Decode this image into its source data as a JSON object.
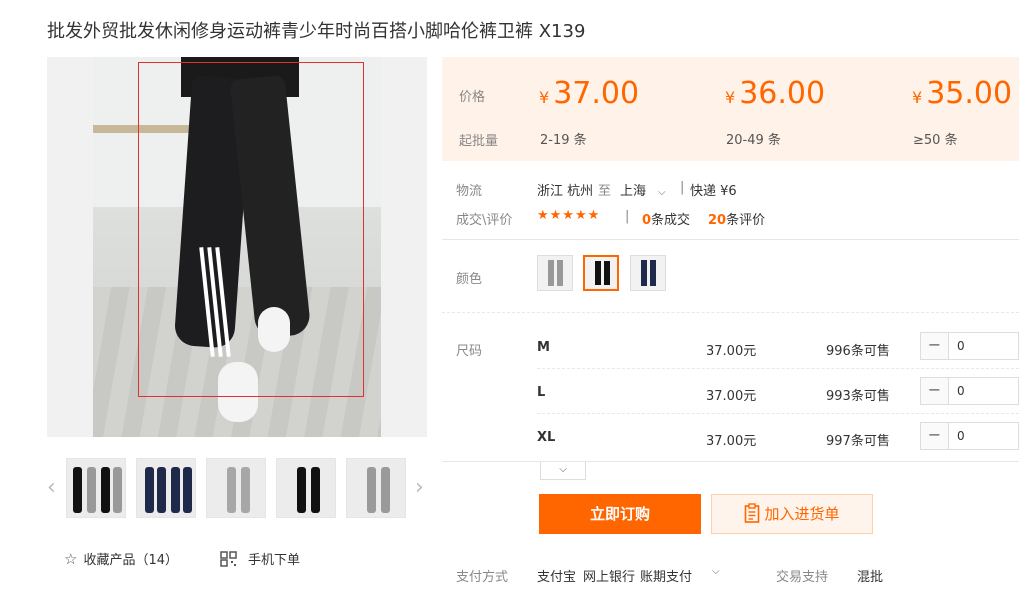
{
  "product": {
    "title": "批发外贸批发休闲修身运动裤青少年时尚百搭小脚哈伦裤卫裤 X139"
  },
  "gallery": {
    "prev_icon": "‹",
    "next_icon": "›"
  },
  "actions": {
    "favorite_label": "收藏产品（14）",
    "mobile_label": "手机下单"
  },
  "pricing": {
    "price_label": "价格",
    "batch_label": "起批量",
    "currency": "¥",
    "tiers": [
      {
        "price": "37.00",
        "batch": "2-19 条"
      },
      {
        "price": "36.00",
        "batch": "20-49 条"
      },
      {
        "price": "35.00",
        "batch": "≥50 条"
      }
    ]
  },
  "logistics": {
    "label": "物流",
    "from": "浙江 杭州",
    "to_word": "至",
    "to": "上海",
    "shipping": "快递 ¥6"
  },
  "reviews": {
    "label": "成交\\评价",
    "stars": "★★★★★",
    "deals_count": "0",
    "deals_text": "条成交",
    "review_count": "20",
    "review_text": "条评价"
  },
  "color": {
    "label": "颜色",
    "selected_index": 1
  },
  "sizes": {
    "label": "尺码",
    "rows": [
      {
        "size": "M",
        "price": "37.00元",
        "stock": "996条可售",
        "qty": "0"
      },
      {
        "size": "L",
        "price": "37.00元",
        "stock": "993条可售",
        "qty": "0"
      },
      {
        "size": "XL",
        "price": "37.00元",
        "stock": "997条可售",
        "qty": "0"
      }
    ]
  },
  "buttons": {
    "buy_now": "立即订购",
    "add_to_list": "加入进货单"
  },
  "payment": {
    "label": "支付方式",
    "methods": [
      "支付宝",
      "网上银行",
      "账期支付"
    ],
    "trade_label": "交易支持",
    "trade_value": "混批"
  },
  "colors": {
    "accent": "#ff6600",
    "price_bg": "#fff2e8"
  }
}
